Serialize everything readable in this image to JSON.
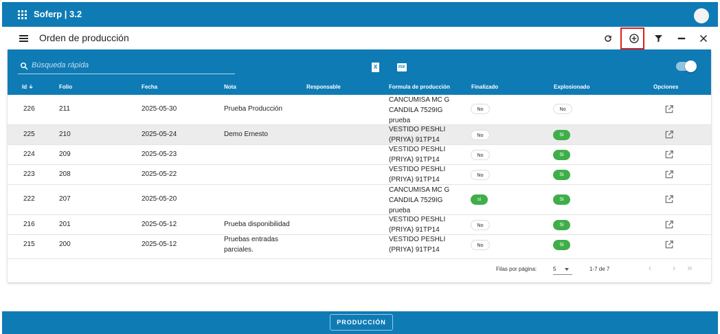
{
  "app": {
    "title": "Soferp | 3.2"
  },
  "page": {
    "title": "Orden de producción"
  },
  "toolbar": {
    "icons": [
      "refresh-icon",
      "add-circle-icon",
      "filter-icon",
      "minimize-icon",
      "close-icon"
    ]
  },
  "search": {
    "placeholder": "Búsqueda rápida",
    "value": ""
  },
  "export": {
    "excel_label": "X",
    "pdf_label": "PDF"
  },
  "table": {
    "headers": {
      "id": "Id",
      "folio": "Folio",
      "fecha": "Fecha",
      "nota": "Nota",
      "responsable": "Responsable",
      "formula": "Formula de producción",
      "finalizado": "Finalizado",
      "explosionado": "Explosionado",
      "opciones": "Opciones"
    },
    "rows": [
      {
        "id": "226",
        "folio": "211",
        "fecha": "2025-05-30",
        "nota": "Prueba Producción",
        "responsable": "",
        "formula": "CANCUMISA MC G CANDILA 7529IG prueba",
        "finalizado": "No",
        "explosionado": "No"
      },
      {
        "id": "225",
        "folio": "210",
        "fecha": "2025-05-24",
        "nota": "Demo Ernesto",
        "responsable": "",
        "formula": "VESTIDO PESHLI (PRIYA) 91TP14",
        "finalizado": "No",
        "explosionado": "Si"
      },
      {
        "id": "224",
        "folio": "209",
        "fecha": "2025-05-23",
        "nota": "",
        "responsable": "",
        "formula": "VESTIDO PESHLI (PRIYA) 91TP14",
        "finalizado": "No",
        "explosionado": "Si"
      },
      {
        "id": "223",
        "folio": "208",
        "fecha": "2025-05-22",
        "nota": "",
        "responsable": "",
        "formula": "VESTIDO PESHLI (PRIYA) 91TP14",
        "finalizado": "No",
        "explosionado": "Si"
      },
      {
        "id": "222",
        "folio": "207",
        "fecha": "2025-05-20",
        "nota": "",
        "responsable": "",
        "formula": "CANCUMISA MC G CANDILA 7529IG prueba",
        "finalizado": "si",
        "explosionado": "Si"
      },
      {
        "id": "216",
        "folio": "201",
        "fecha": "2025-05-12",
        "nota": "Prueba disponibilidad",
        "responsable": "",
        "formula": "VESTIDO PESHLI (PRIYA) 91TP14",
        "finalizado": "No",
        "explosionado": "Si"
      },
      {
        "id": "215",
        "folio": "200",
        "fecha": "2025-05-12",
        "nota": "Pruebas entradas parciales.",
        "responsable": "",
        "formula": "VESTIDO PESHLI (PRIYA) 91TP14",
        "finalizado": "No",
        "explosionado": "Si"
      }
    ]
  },
  "pagination": {
    "rows_per_page_label": "Filas por página:",
    "rows_per_page": "5",
    "range": "1-7 de 7",
    "prev": "‹",
    "next": "›",
    "last": "»"
  },
  "bottom": {
    "button_label": "PRODUCCIÓN"
  },
  "colors": {
    "primary": "#0f7bb5",
    "success": "#3fae49",
    "highlight": "#e01b1b"
  }
}
